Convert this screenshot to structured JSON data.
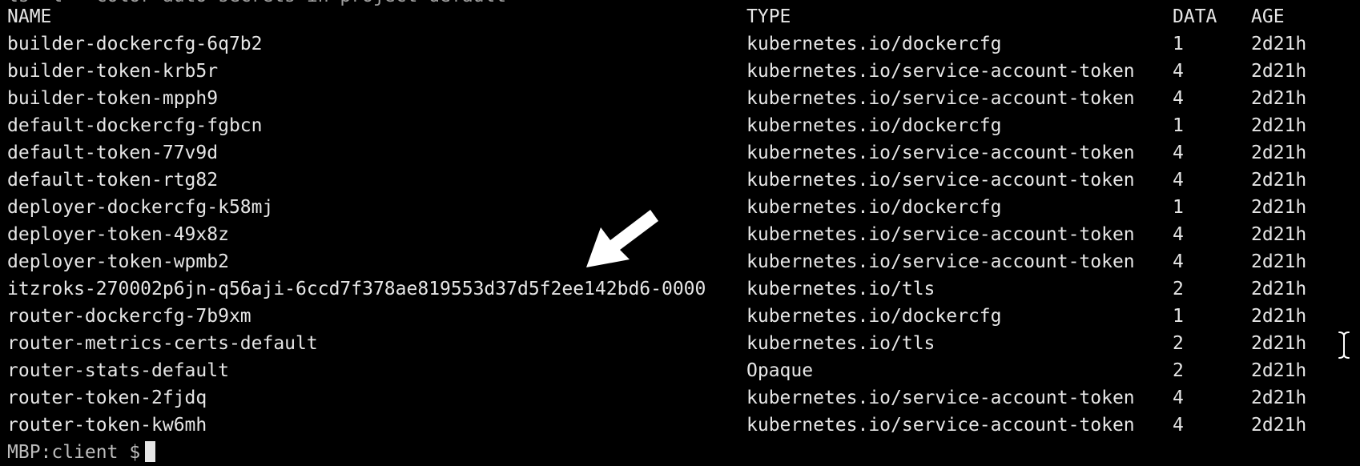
{
  "terminal": {
    "partial_top_line": "ls  -l  --color=auto  secrets  in  project  default",
    "headers": {
      "name": "NAME",
      "type": "TYPE",
      "data": "DATA",
      "age": "AGE"
    },
    "rows": [
      {
        "name": "builder-dockercfg-6q7b2",
        "type": "kubernetes.io/dockercfg",
        "data": "1",
        "age": "2d21h"
      },
      {
        "name": "builder-token-krb5r",
        "type": "kubernetes.io/service-account-token",
        "data": "4",
        "age": "2d21h"
      },
      {
        "name": "builder-token-mpph9",
        "type": "kubernetes.io/service-account-token",
        "data": "4",
        "age": "2d21h"
      },
      {
        "name": "default-dockercfg-fgbcn",
        "type": "kubernetes.io/dockercfg",
        "data": "1",
        "age": "2d21h"
      },
      {
        "name": "default-token-77v9d",
        "type": "kubernetes.io/service-account-token",
        "data": "4",
        "age": "2d21h"
      },
      {
        "name": "default-token-rtg82",
        "type": "kubernetes.io/service-account-token",
        "data": "4",
        "age": "2d21h"
      },
      {
        "name": "deployer-dockercfg-k58mj",
        "type": "kubernetes.io/dockercfg",
        "data": "1",
        "age": "2d21h"
      },
      {
        "name": "deployer-token-49x8z",
        "type": "kubernetes.io/service-account-token",
        "data": "4",
        "age": "2d21h"
      },
      {
        "name": "deployer-token-wpmb2",
        "type": "kubernetes.io/service-account-token",
        "data": "4",
        "age": "2d21h"
      },
      {
        "name": "itzroks-270002p6jn-q56aji-6ccd7f378ae819553d37d5f2ee142bd6-0000",
        "type": "kubernetes.io/tls",
        "data": "2",
        "age": "2d21h"
      },
      {
        "name": "router-dockercfg-7b9xm",
        "type": "kubernetes.io/dockercfg",
        "data": "1",
        "age": "2d21h"
      },
      {
        "name": "router-metrics-certs-default",
        "type": "kubernetes.io/tls",
        "data": "2",
        "age": "2d21h"
      },
      {
        "name": "router-stats-default",
        "type": "Opaque",
        "data": "2",
        "age": "2d21h"
      },
      {
        "name": "router-token-2fjdq",
        "type": "kubernetes.io/service-account-token",
        "data": "4",
        "age": "2d21h"
      },
      {
        "name": "router-token-kw6mh",
        "type": "kubernetes.io/service-account-token",
        "data": "4",
        "age": "2d21h"
      }
    ],
    "prompt": "MBP:client $",
    "colors": {
      "background": "#000000",
      "text": "#e6e6e6"
    },
    "icons": {
      "annotation": "arrow-icon",
      "pointer": "ibeam-cursor-icon"
    }
  }
}
